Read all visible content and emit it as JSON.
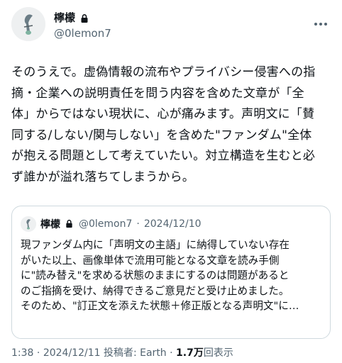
{
  "header": {
    "display_name": "檸檬",
    "handle": "@0lemon7",
    "more_icon": "more-icon",
    "lock_icon": "lock-icon"
  },
  "tweet": {
    "text": "そのうえで。虚偽情報の流布やプライバシー侵害への指\n摘・企業への説明責任を問う内容を含めた文章が「全\n体」からではない現状に、心が痛みます。声明文に「賛\n同する/しない/関与しない」を含めた\"ファンダム\"全体\nが抱える問題として考えていたい。対立構造を生むと必\nず誰かが溢れ落ちてしまうから。"
  },
  "quote": {
    "display_name": "檸檬",
    "handle": "@0lemon7",
    "separator": "·",
    "date": "2024/12/10",
    "text": "現ファンダム内に「声明文の主語」に納得していない存在\nがいた以上、画像単体で流用可能となる文章を読み手側\nに\"読み替え\"を求める状態のままにするのは問題があると\nのご指摘を受け、納得できるご意見だと受け止めました。\nそのため、\"訂正文を添えた状態＋修正版となる声明文\"に…"
  },
  "footer": {
    "time": "1:38",
    "dot1": "·",
    "date": "2024/12/11",
    "poster_label": "投稿者: Earth",
    "dot2": "·",
    "views_count": "1.7万",
    "views_label": "回表示"
  }
}
